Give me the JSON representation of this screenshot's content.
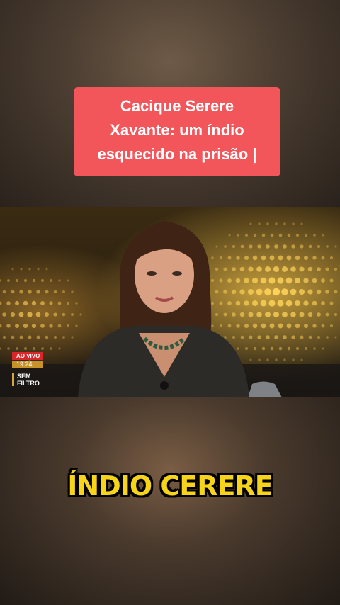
{
  "headline": {
    "line1": "Cacique Serere",
    "line2": "Xavante: um índio",
    "line3": "esquecido na prisão |"
  },
  "video": {
    "badge_live": "AO VIVO",
    "badge_time": "19:24",
    "logo_line1": "SEM",
    "logo_line2": "FILTRO",
    "icons": [
      "qr-code-icon"
    ]
  },
  "caption": {
    "text": "ÍNDIO CERERE"
  },
  "colors": {
    "headline_bg": "#f2555a",
    "caption_text": "#f7d31a",
    "live_badge": "#d8262a",
    "time_badge": "#c7922a"
  }
}
